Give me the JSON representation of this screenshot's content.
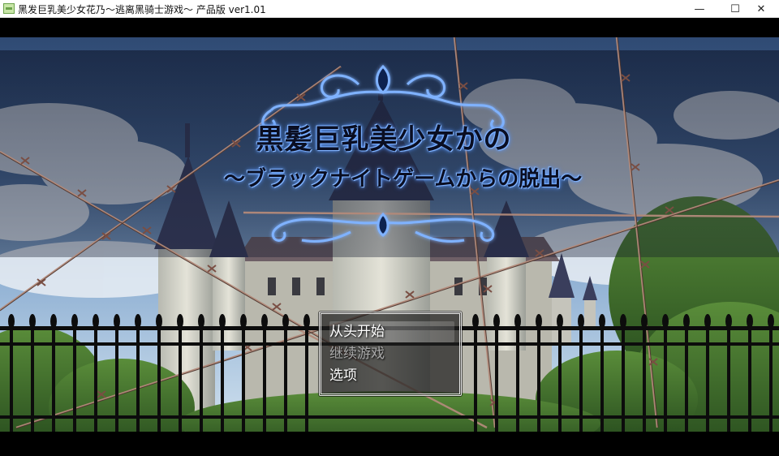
{
  "window": {
    "title": "黑发巨乳美少女花乃～逃离黑骑士游戏～ 产品版 ver1.01",
    "minimize_glyph": "—",
    "maximize_glyph": "☐",
    "close_glyph": "✕"
  },
  "logo": {
    "line1": "黒髪巨乳美少女かの",
    "line2": "〜ブラックナイトゲームからの脱出〜"
  },
  "menu": {
    "items": [
      {
        "label": "从头开始",
        "state": "selected"
      },
      {
        "label": "继续游戏",
        "state": "disabled"
      },
      {
        "label": "选项",
        "state": "enabled"
      }
    ]
  },
  "colors": {
    "logo_glow": "#4f8dff",
    "menu_border": "#e9e9e9",
    "menu_bg": "#1e1e1e"
  }
}
